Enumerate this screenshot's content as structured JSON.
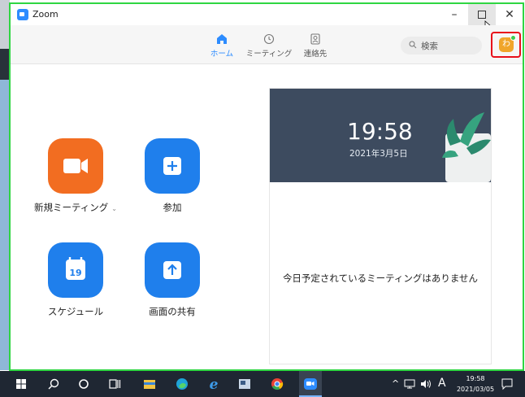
{
  "window": {
    "title": "Zoom"
  },
  "nav": {
    "tabs": [
      {
        "label": "ホーム",
        "icon": "home-icon",
        "active": true
      },
      {
        "label": "ミーティング",
        "icon": "clock-icon",
        "active": false
      },
      {
        "label": "連絡先",
        "icon": "contacts-icon",
        "active": false
      }
    ],
    "search_label": "検索",
    "avatar_initial": "わ"
  },
  "actions": {
    "new_meeting": "新規ミーティング",
    "join": "参加",
    "schedule": "スケジュール",
    "schedule_day": "19",
    "share_screen": "画面の共有"
  },
  "panel": {
    "time": "19:58",
    "date": "2021年3月5日",
    "empty_message": "今日予定されているミーティングはありません"
  },
  "taskbar": {
    "ime": "A",
    "clock_time": "19:58",
    "clock_date": "2021/03/05"
  },
  "colors": {
    "accent": "#2d8cff",
    "new_meeting": "#f26d21",
    "tile_blue": "#1f7fec",
    "highlight_green": "#2fd642",
    "highlight_red": "#e8101b"
  }
}
